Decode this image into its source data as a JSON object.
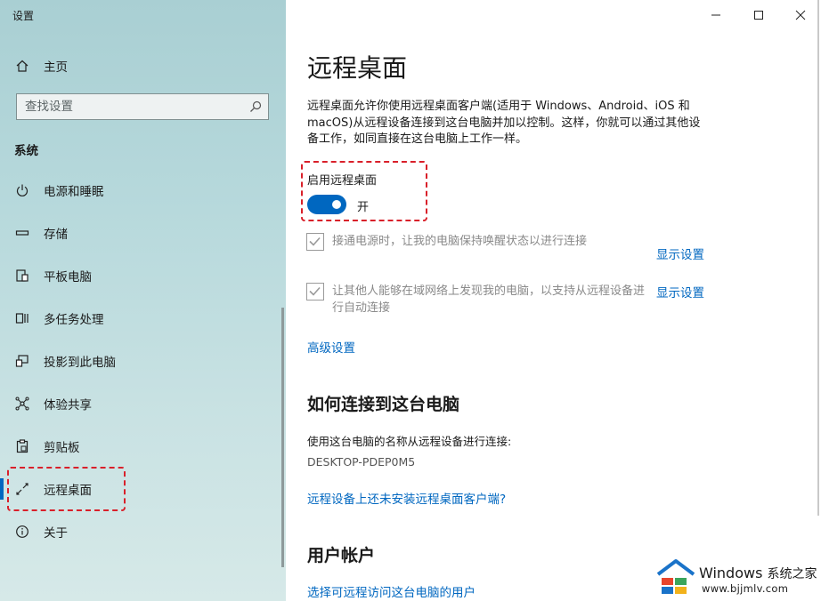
{
  "window": {
    "title": "设置"
  },
  "sidebar": {
    "home_label": "主页",
    "search": {
      "placeholder": "查找设置"
    },
    "section_label": "系统",
    "items": [
      {
        "label": "电源和睡眠",
        "icon": "power-icon"
      },
      {
        "label": "存储",
        "icon": "storage-icon"
      },
      {
        "label": "平板电脑",
        "icon": "tablet-icon"
      },
      {
        "label": "多任务处理",
        "icon": "multitasking-icon"
      },
      {
        "label": "投影到此电脑",
        "icon": "project-icon"
      },
      {
        "label": "体验共享",
        "icon": "shared-experiences-icon"
      },
      {
        "label": "剪贴板",
        "icon": "clipboard-icon"
      },
      {
        "label": "远程桌面",
        "icon": "remote-desktop-icon",
        "active": true
      },
      {
        "label": "关于",
        "icon": "info-icon"
      }
    ]
  },
  "main": {
    "title": "远程桌面",
    "description": "远程桌面允许你使用远程桌面客户端(适用于 Windows、Android、iOS 和 macOS)从远程设备连接到这台电脑并加以控制。这样，你就可以通过其他设备工作，如同直接在这台电脑上工作一样。",
    "toggle": {
      "label": "启用远程桌面",
      "state_text": "开",
      "on": true
    },
    "options": [
      {
        "text": "接通电源时，让我的电脑保持唤醒状态以进行连接",
        "link": "显示设置",
        "checked": true
      },
      {
        "text": "让其他人能够在域网络上发现我的电脑，以支持从远程设备进行自动连接",
        "link": "显示设置",
        "checked": true
      }
    ],
    "advanced_link": "高级设置",
    "connect": {
      "heading": "如何连接到这台电脑",
      "instruction": "使用这台电脑的名称从远程设备进行连接:",
      "pc_name": "DESKTOP-PDEP0M5",
      "client_link": "远程设备上还未安装远程桌面客户端?"
    },
    "accounts": {
      "heading": "用户帐户",
      "link": "选择可远程访问这台电脑的用户"
    }
  },
  "watermark": {
    "word": "Windows",
    "brand": "系统之家",
    "url": "www.bjjmlv.com"
  },
  "colors": {
    "accent": "#0067c0",
    "highlight": "#d9202a",
    "sidebar_bg": "#b7d9dc"
  }
}
